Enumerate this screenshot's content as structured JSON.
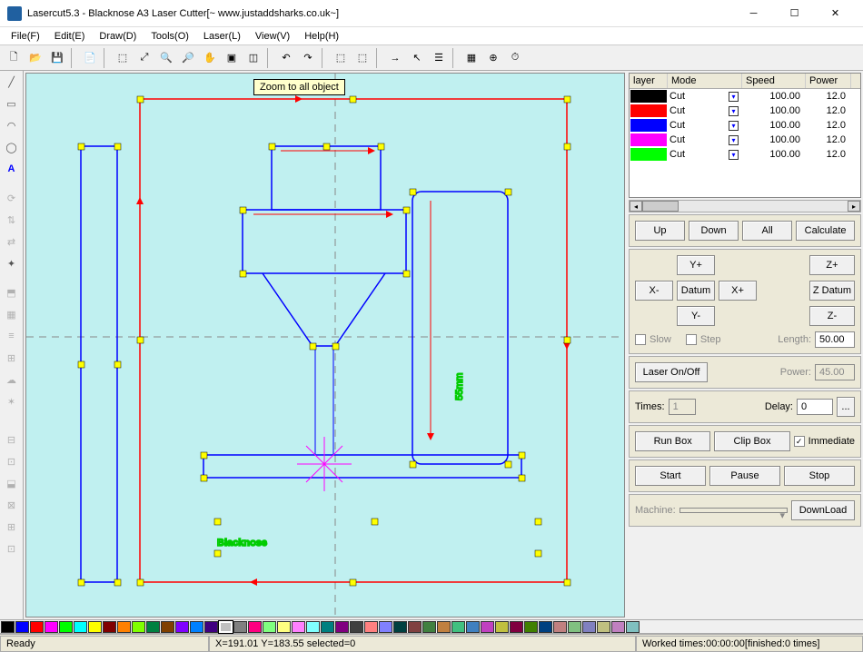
{
  "title": "Lasercut5.3 - Blacknose A3 Laser Cutter[~ www.justaddsharks.co.uk~]",
  "menu": [
    "File(F)",
    "Edit(E)",
    "Draw(D)",
    "Tools(O)",
    "Laser(L)",
    "View(V)",
    "Help(H)"
  ],
  "tooltip": "Zoom to all object",
  "layers": {
    "headers": [
      "layer",
      "Mode",
      "Speed",
      "Power"
    ],
    "rows": [
      {
        "color": "#000000",
        "mode": "Cut",
        "speed": "100.00",
        "power": "12.0"
      },
      {
        "color": "#ff0000",
        "mode": "Cut",
        "speed": "100.00",
        "power": "12.0"
      },
      {
        "color": "#0000ff",
        "mode": "Cut",
        "speed": "100.00",
        "power": "12.0"
      },
      {
        "color": "#ff00ff",
        "mode": "Cut",
        "speed": "100.00",
        "power": "12.0"
      },
      {
        "color": "#00ff00",
        "mode": "Cut",
        "speed": "100.00",
        "power": "12.0"
      }
    ]
  },
  "buttons": {
    "up": "Up",
    "down": "Down",
    "all": "All",
    "calculate": "Calculate",
    "yplus": "Y+",
    "zplus": "Z+",
    "xminus": "X-",
    "datum": "Datum",
    "xplus": "X+",
    "zdatum": "Z Datum",
    "yminus": "Y-",
    "zminus": "Z-",
    "slow": "Slow",
    "step": "Step",
    "length_lbl": "Length:",
    "length_val": "50.00",
    "laser": "Laser On/Off",
    "power_lbl": "Power:",
    "power_val": "45.00",
    "times_lbl": "Times:",
    "times_val": "1",
    "delay_lbl": "Delay:",
    "delay_val": "0",
    "more": "...",
    "runbox": "Run Box",
    "clipbox": "Clip Box",
    "immediate": "Immediate",
    "start": "Start",
    "pause": "Pause",
    "stop": "Stop",
    "machine_lbl": "Machine:",
    "download": "DownLoad"
  },
  "palette": [
    "#000000",
    "#0000ff",
    "#ff0000",
    "#ff00ff",
    "#00ff00",
    "#00ffff",
    "#ffff00",
    "#800000",
    "#ff8000",
    "#80ff00",
    "#008040",
    "#804000",
    "#8000ff",
    "#0080ff",
    "#400080",
    "#c0c0c0",
    "#808080",
    "#ff0080",
    "#80ff80",
    "#ffff80",
    "#ff80ff",
    "#80ffff",
    "#008080",
    "#800080",
    "#404040",
    "#ff8080",
    "#8080ff",
    "#004040",
    "#804040",
    "#408040",
    "#c08040",
    "#40c080",
    "#4080c0",
    "#c040c0",
    "#c0c040",
    "#800040",
    "#408000",
    "#004080",
    "#c08080",
    "#80c080",
    "#8080c0",
    "#c0c080",
    "#c080c0",
    "#80c0c0"
  ],
  "status": {
    "ready": "Ready",
    "coord": "X=191.01 Y=183.55 selected=0",
    "worked": "Worked times:00:00:00[finished:0 times]"
  },
  "canvas_text": {
    "t55mm": "55mm",
    "blacknose": "Blacknose"
  }
}
